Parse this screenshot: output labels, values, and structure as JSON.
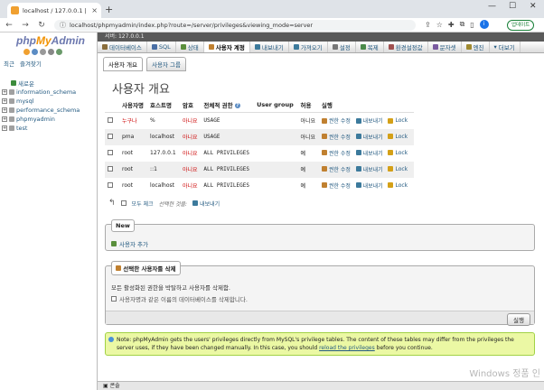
{
  "browser": {
    "tab_title": "localhost / 127.0.0.1 | phpMyAdm",
    "url": "localhost/phpmyadmin/index.php?route=/server/privileges&viewing_mode=server",
    "update_label": "업데이트"
  },
  "nav": {
    "logo": {
      "php": "php",
      "my": "My",
      "admin": "Admin"
    },
    "tabs": [
      "최근",
      "즐겨찾기"
    ],
    "databases": [
      {
        "label": "새로운",
        "kind": "new"
      },
      {
        "label": "information_schema",
        "kind": "db"
      },
      {
        "label": "mysql",
        "kind": "db"
      },
      {
        "label": "performance_schema",
        "kind": "db"
      },
      {
        "label": "phpmyadmin",
        "kind": "db"
      },
      {
        "label": "test",
        "kind": "db"
      }
    ]
  },
  "main": {
    "server_label": "서버: 127.0.0.1",
    "menu": [
      {
        "label": "데이터베이스",
        "color": "#8a6d3b"
      },
      {
        "label": "SQL",
        "color": "#4a6fa5"
      },
      {
        "label": "상태",
        "color": "#5a8f3c"
      },
      {
        "label": "사용자 계정",
        "color": "#c08030",
        "active": true
      },
      {
        "label": "내보내기",
        "color": "#3c7a9c"
      },
      {
        "label": "가져오기",
        "color": "#3c7a9c"
      },
      {
        "label": "설정",
        "color": "#777777"
      },
      {
        "label": "복제",
        "color": "#4a8a4a"
      },
      {
        "label": "환경설정값",
        "color": "#a05050"
      },
      {
        "label": "문자셋",
        "color": "#7a5aa0"
      },
      {
        "label": "엔진",
        "color": "#a08a30"
      },
      {
        "label": "더보기",
        "color": "#555555"
      }
    ],
    "subtabs": [
      "사용자 개요",
      "사용자 그룹"
    ],
    "page_title": "사용자 개요",
    "table": {
      "headers": [
        "사용자명",
        "호스트명",
        "암호",
        "전체적 권한",
        "User group",
        "허용",
        "실행"
      ],
      "rows": [
        {
          "user": "누구나",
          "host": "%",
          "password": "아니요",
          "privileges": "USAGE",
          "group": "",
          "grant": "아니요"
        },
        {
          "user": "pma",
          "host": "localhost",
          "password": "아니요",
          "privileges": "USAGE",
          "group": "",
          "grant": "아니요"
        },
        {
          "user": "root",
          "host": "127.0.0.1",
          "password": "아니요",
          "privileges": "ALL PRIVILEGES",
          "group": "",
          "grant": "예"
        },
        {
          "user": "root",
          "host": "::1",
          "password": "아니요",
          "privileges": "ALL PRIVILEGES",
          "group": "",
          "grant": "예"
        },
        {
          "user": "root",
          "host": "localhost",
          "password": "아니요",
          "privileges": "ALL PRIVILEGES",
          "group": "",
          "grant": "예"
        }
      ],
      "action_labels": {
        "edit": "권한 수정",
        "export": "내보내기",
        "lock": "Lock"
      }
    },
    "bulk": {
      "check_all": "모두 체크",
      "with_selected": "선택한 것을:",
      "export": "내보내기"
    },
    "new_section": {
      "legend": "New",
      "add_user": "사용자 추가"
    },
    "delete_section": {
      "legend": "선택한 사용자를 삭제",
      "text": "모든 활성화된 권한을 박탈하고 사용자를 삭제함.",
      "checkbox_label": "사용자명과 같은 이름의 데이터베이스를 삭제합니다.",
      "go": "실행"
    },
    "notice": {
      "text_before": "Note: phpMyAdmin gets the users' privileges directly from MySQL's privilege tables. The content of these tables may differ from the privileges the server uses, if they have been changed manually. In this case, you should ",
      "link": "reload the privileges",
      "text_after": " before you continue."
    },
    "console_label": "콘솔",
    "watermark": "Windows 정품 인"
  }
}
